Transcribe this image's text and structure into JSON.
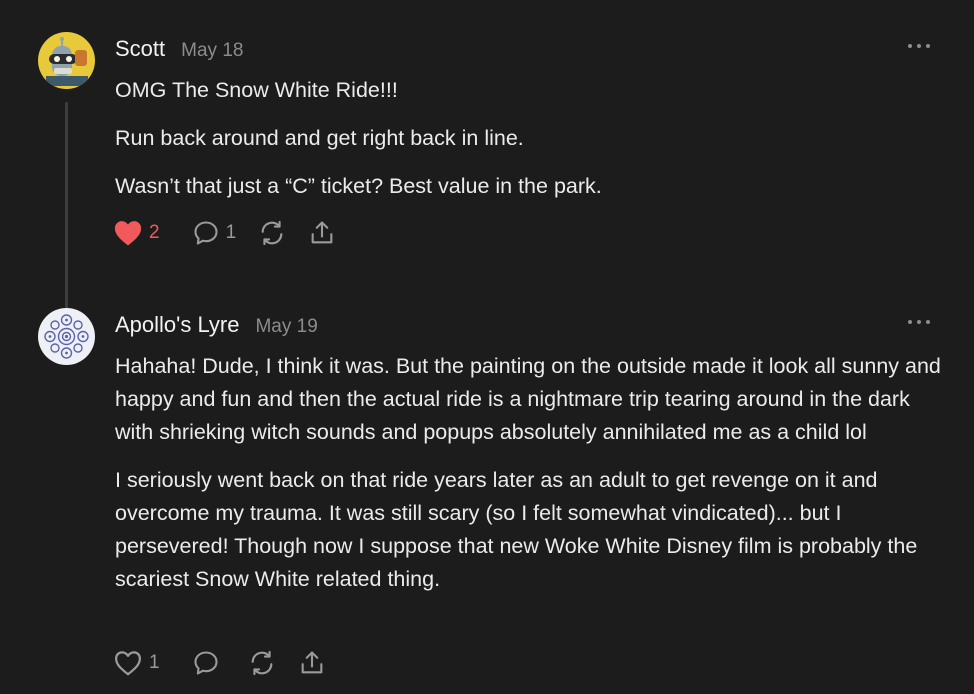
{
  "comments": [
    {
      "author": "Scott",
      "date": "May 18",
      "avatar_icon": "robot-avatar-icon",
      "paragraphs": [
        "OMG The Snow White Ride!!!",
        "Run back around and get right back in line.",
        "Wasn’t that just a “C” ticket? Best value in the park."
      ],
      "likes": "2",
      "liked": true,
      "replies": "1"
    },
    {
      "author": "Apollo's Lyre",
      "date": "May 19",
      "avatar_icon": "lace-pattern-avatar-icon",
      "paragraphs": [
        "Hahaha! Dude, I think it was. But the painting on the outside made it look all sunny and happy and fun and then the actual ride is a nightmare trip tearing around in the dark with shrieking witch sounds and popups absolutely annihilated me as a child lol",
        "I seriously went back on that ride years later as an adult to get revenge on it and overcome my trauma. It was still scary (so I felt somewhat vindicated)... but I persevered! Though now I suppose that new Woke White Disney film is probably the scariest Snow White related thing."
      ],
      "likes": "1",
      "liked": false,
      "replies": ""
    }
  ],
  "colors": {
    "background": "#1c1c1d",
    "liked_heart": "#f05a5a",
    "muted": "#8c8c8f"
  }
}
